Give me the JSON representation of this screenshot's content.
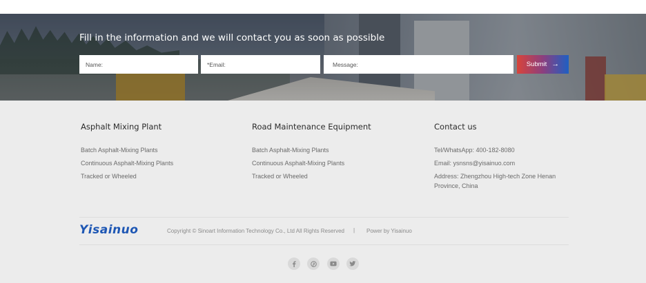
{
  "banner": {
    "headline": "Fill in the information and we will contact you as soon as possible"
  },
  "form": {
    "name_placeholder": "Name:",
    "email_placeholder": "*Email:",
    "message_placeholder": "Message:",
    "submit_label": "Submit",
    "submit_icon": "arrow-right-icon",
    "submit_colors": [
      "#d8443a",
      "#1f5fc3"
    ]
  },
  "footer": {
    "columns": [
      {
        "title": "Asphalt Mixing Plant",
        "links": [
          "Batch Asphalt-Mixing Plants",
          "Continuous Asphalt-Mixing Plants",
          "Tracked or Wheeled"
        ]
      },
      {
        "title": "Road Maintenance Equipment",
        "links": [
          "Batch Asphalt-Mixing Plants",
          "Continuous Asphalt-Mixing Plants",
          "Tracked or Wheeled"
        ]
      }
    ],
    "contact": {
      "title": "Contact us",
      "phone": "Tel/WhatsApp: 400-182-8080",
      "email": "Email: ysnsns@yisainuo.com",
      "address_line1": "Address: Zhengzhou High-tech Zone Henan",
      "address_line2": "Province, China"
    },
    "brand": {
      "logo_text": "Yisainuo",
      "logo_color": "#1e57b4"
    },
    "copyright": "Copyright © Sinoart  Information Technology Co., Ltd  All Rights Reserved",
    "separator": "|",
    "power": "Power by Yisainuo",
    "social": [
      "facebook-icon",
      "pinterest-icon",
      "youtube-icon",
      "twitter-icon"
    ]
  }
}
